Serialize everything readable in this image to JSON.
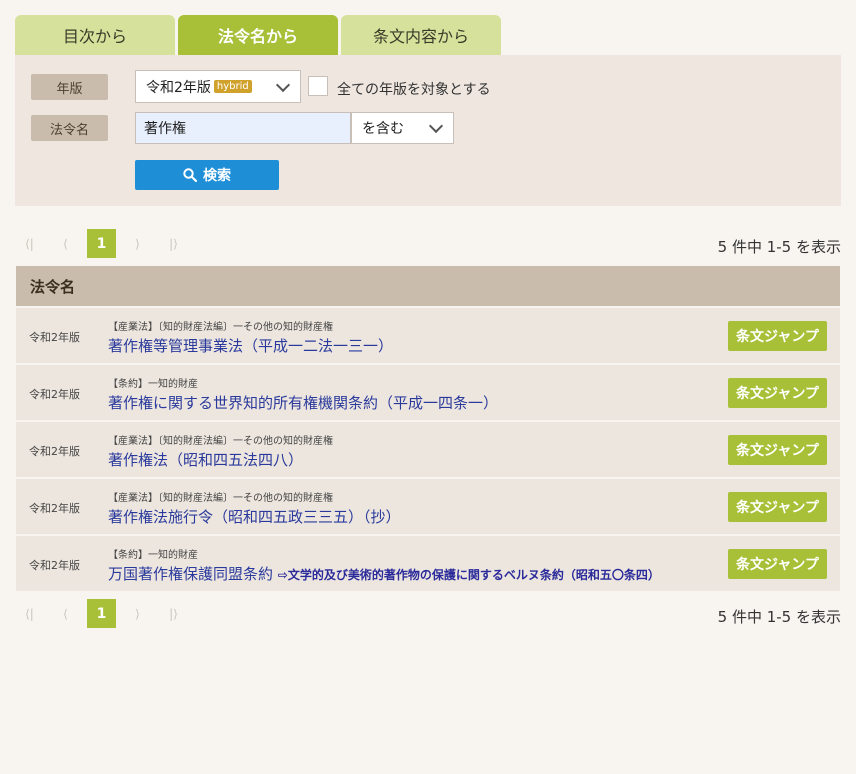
{
  "tabs": [
    {
      "label": "目次から",
      "active": false
    },
    {
      "label": "法令名から",
      "active": true
    },
    {
      "label": "条文内容から",
      "active": false
    }
  ],
  "form": {
    "year_label": "年版",
    "year_value": "令和2年版",
    "year_badge": "hybrid",
    "all_years_label": "全ての年版を対象とする",
    "name_label": "法令名",
    "name_value": "著作権",
    "match_value": "を含む",
    "search_label": "検索"
  },
  "pager": {
    "first": "⟨|",
    "prev": "⟨",
    "current": "1",
    "next": "⟩",
    "last": "|⟩",
    "count_text": "5 件中 1-5 を表示"
  },
  "table": {
    "header": "法令名",
    "jump_label": "条文ジャンプ",
    "rows": [
      {
        "year": "令和2年版",
        "category": "【産業法】〔知的財産法編〕一その他の知的財産権",
        "title": "著作権等管理事業法（平成一二法一三一）",
        "ref": ""
      },
      {
        "year": "令和2年版",
        "category": "【条約】一知的財産",
        "title": "著作権に関する世界知的所有権機関条約（平成一四条一）",
        "ref": ""
      },
      {
        "year": "令和2年版",
        "category": "【産業法】〔知的財産法編〕一その他の知的財産権",
        "title": "著作権法（昭和四五法四八）",
        "ref": ""
      },
      {
        "year": "令和2年版",
        "category": "【産業法】〔知的財産法編〕一その他の知的財産権",
        "title": "著作権法施行令（昭和四五政三三五）（抄）",
        "ref": ""
      },
      {
        "year": "令和2年版",
        "category": "【条約】一知的財産",
        "title": "万国著作権保護同盟条約",
        "ref": "⇨文学的及び美術的著作物の保護に関するベルヌ条約（昭和五〇条四）"
      }
    ]
  },
  "colors": {
    "accent": "#a8c037",
    "tab_inactive": "#d6e29b",
    "search_button": "#1e8fd6",
    "header_bg": "#c9bcad",
    "row_bg": "#ede6df",
    "link": "#2a3a9c"
  }
}
